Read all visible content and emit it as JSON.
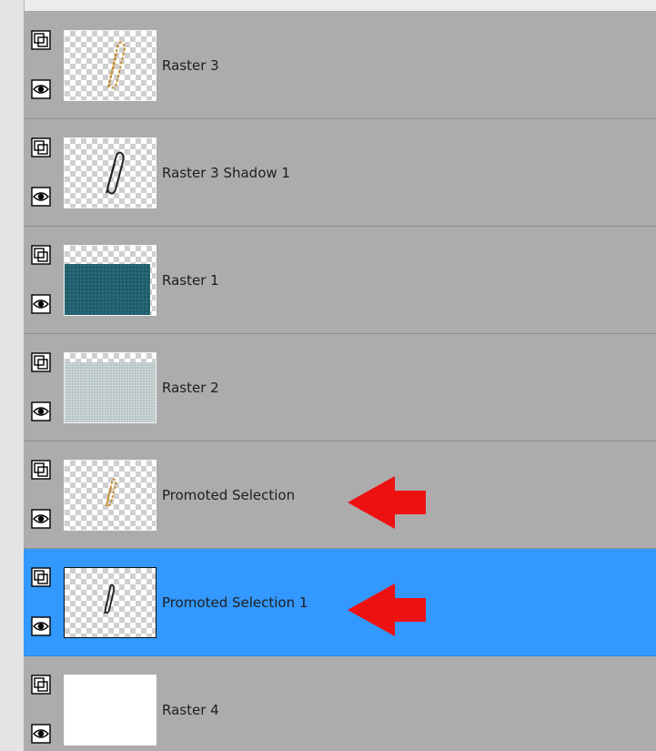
{
  "layers": [
    {
      "name": "Raster 3",
      "thumb": "paperclip-gold",
      "selected": false,
      "arrow": false
    },
    {
      "name": "Raster 3 Shadow 1",
      "thumb": "paperclip-dark",
      "selected": false,
      "arrow": false
    },
    {
      "name": "Raster 1",
      "thumb": "teal-texture",
      "selected": false,
      "arrow": false
    },
    {
      "name": "Raster 2",
      "thumb": "grey-texture",
      "selected": false,
      "arrow": false
    },
    {
      "name": "Promoted Selection",
      "thumb": "paperclip-gold-small",
      "selected": false,
      "arrow": true
    },
    {
      "name": "Promoted Selection 1",
      "thumb": "paperclip-dark-small",
      "selected": true,
      "arrow": true
    },
    {
      "name": "Raster 4",
      "thumb": "white",
      "selected": false,
      "arrow": false
    }
  ],
  "icons": {
    "lock": "link-layer-icon",
    "visibility": "eye-icon",
    "annotation": "red-arrow-icon"
  },
  "colors": {
    "panel_bg": "#acacac",
    "selected_bg": "#3399ff",
    "arrow": "#ee1111"
  }
}
